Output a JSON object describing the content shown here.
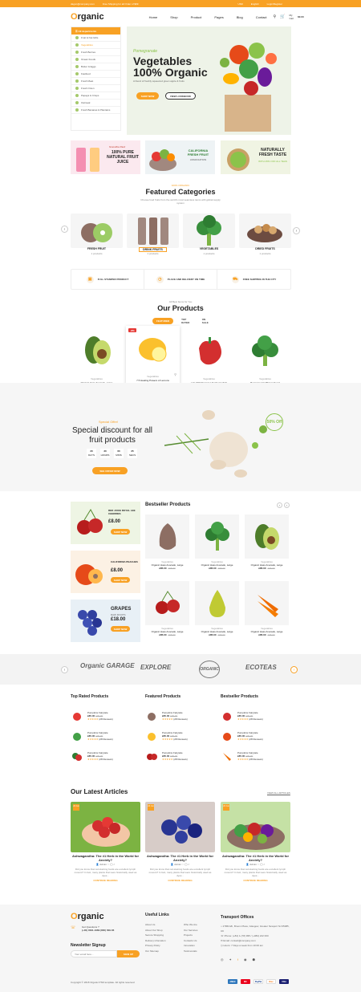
{
  "topbar": {
    "email": "dagon@company.com",
    "shipping": "Free Shipping for all Order of $99",
    "currency": "USD",
    "language": "English",
    "login": "Login/Register"
  },
  "header": {
    "logo_a": "O",
    "logo_b": "rganic",
    "nav": [
      "Home",
      "Shop",
      "Product",
      "Pages",
      "Blog",
      "Contact"
    ],
    "cart_label": "My Cart",
    "cart_total": "$0.00"
  },
  "categories": {
    "title": "All departments",
    "items": [
      "Fruit & Nut Gifts",
      "Vegetables",
      "Fresh Berries",
      "Ocean Foods",
      "Butter & Eggs",
      "Fastfood",
      "Fresh Meat",
      "Fresh Onion",
      "Papaya & Crisps",
      "Oatmeal",
      "Fresh Bananas & Plantains"
    ]
  },
  "hero": {
    "kicker": "Pomegranate",
    "title": "Vegetables 100% Organic",
    "desc": "A blend of freshly squeezed green apple & fruits",
    "btn1": "SHOP NOW",
    "btn2": "VIEW LOOKBOOK"
  },
  "promos": [
    {
      "sub": "Smoothie Pack",
      "title": "100% PURE NATURAL FRUIT JUICE"
    },
    {
      "title": "CALIFORNIA FRESH FRUIT",
      "sub": "ASSOCIATION"
    },
    {
      "title": "NATURALLY FRESH TASTE",
      "sub": "WITH 25% OFF ALL TEAS"
    }
  ],
  "featured": {
    "tag": "100% ORGANIC",
    "title": "Featured Categories",
    "sub": "Choose food fruits from the world's most seamless items with global supply system",
    "items": [
      {
        "name": "FRESH FRUIT",
        "count": "1 products"
      },
      {
        "name": "DRINK FRUITS",
        "count": "1 products"
      },
      {
        "name": "VEGETABLES",
        "count": "1 products"
      },
      {
        "name": "DRIED FRUITS",
        "count": "1 products"
      }
    ]
  },
  "features": [
    "FULL STAMPED PRODUCT",
    "PLACE AND DELIVERY ON TIME",
    "FREE SHIPPING IN THE CITY"
  ],
  "products": {
    "tag": "All Best Items for You",
    "title": "Our Products",
    "tabs": [
      "FEATURED",
      "TOP RATED",
      "ON SALE"
    ],
    "items": [
      {
        "cat": "Vegetables",
        "name": "Organic Hass Avocado, Large",
        "price": "£85.00",
        "old": "£95.00"
      },
      {
        "cat": "Vegetables",
        "name": "7.5 Healing Powers of Lemons",
        "price": "£85.00",
        "old": "£95.00",
        "badge": "-8%",
        "note": "80 products are currently selected to ensure fresh safety",
        "btn": "ADD TO CART"
      },
      {
        "cat": "Vegetables",
        "name": "Hot Chili Peppers Himalayan Salt",
        "price": "£85.00",
        "old": "£95.00"
      },
      {
        "cat": "Vegetables",
        "name": "Poonsam Cauliflower Kugel",
        "price": "£85.00",
        "old": "£95.00"
      }
    ]
  },
  "special": {
    "tag": "Special Offer!",
    "title": "Special discount for all fruit products",
    "countdown": [
      {
        "v": "20",
        "l": "DAYS"
      },
      {
        "v": "30",
        "l": "HOURS"
      },
      {
        "v": "60",
        "l": "MINS"
      },
      {
        "v": "25",
        "l": "SECS"
      }
    ],
    "btn": "SEE OFFER NOW",
    "badge": "50% Off"
  },
  "side": [
    {
      "title": "RED JUICE ROYAL LEE CHERRIES",
      "price": "£8.00",
      "btn": "SHOP NOW"
    },
    {
      "title": "CALIFORNIA PEACHES",
      "price": "£8.00",
      "btn": "SHOP NOW"
    },
    {
      "title": "GRAPES",
      "sub": "RAW FRUITS",
      "price": "£18.00",
      "btn": "SHOP NOW"
    }
  ],
  "bestseller": {
    "title": "Bestseller Products",
    "items": [
      {
        "cat": "Vegetables",
        "name": "Organic Hass Avocado, Large",
        "price": "£85.00",
        "old": "£95.00"
      },
      {
        "cat": "Vegetables",
        "name": "Organic Hass Avocado, Large",
        "price": "£85.00",
        "old": "£95.00"
      },
      {
        "cat": "Vegetables",
        "name": "Organic Hass Avocado, Large",
        "price": "£85.00",
        "old": "£95.00"
      },
      {
        "cat": "Vegetables",
        "name": "Organic Hass Avocado, Large",
        "price": "£85.00",
        "old": "£95.00"
      },
      {
        "cat": "Vegetables",
        "name": "Organic Hass Avocado, Large",
        "price": "£85.00",
        "old": "£95.00"
      },
      {
        "cat": "Vegetables",
        "name": "Organic Hass Avocado, Large",
        "price": "£85.00",
        "old": "£95.00"
      }
    ]
  },
  "brands": [
    "Organic GARAGE",
    "EXPLORE",
    "ORGANIC",
    "ECOTEAS"
  ],
  "lists": [
    {
      "title": "Top Rated Products"
    },
    {
      "title": "Featured Products"
    },
    {
      "title": "Bestseller Products"
    }
  ],
  "list_item": {
    "name": "Pumpkins Fairytale",
    "price": "£85.00",
    "old": "£95.00",
    "reviews": "(28 Reviews)"
  },
  "articles": {
    "title": "Our Latest Articles",
    "viewall": "VIEW ALL ARTICLES",
    "date": "24 Jun",
    "author": "Admin",
    "items": [
      {
        "title": "Ashwagandha: The #1 Herb in the World for Anxiety?",
        "ex": "Did you know that red-staining foods are excellent lymph movers? In fact, many plants that were historically used as dyes..."
      },
      {
        "title": "Ashwagandha: The #1 Herb in the World for Anxiety?",
        "ex": "Did you know that red-staining foods are excellent lymph movers? In fact, many plants that were historically used as dyes..."
      },
      {
        "title": "Ashwagandha: The #1 Herb in the World for Anxiety?",
        "ex": "Did you know that red-staining foods are excellent lymph movers? In fact, many plants that were historically used as dyes..."
      }
    ],
    "read": "CONTINUE READING"
  },
  "footer": {
    "q": "Got Questions ?",
    "phone": "(+00) 0091-1989 (800) 609-66",
    "news": "Newsletter Signup",
    "email_ph": "Your email here...",
    "signup": "SIGN UP",
    "links_title": "Useful Links",
    "links1": [
      "About Us",
      "About Our Shop",
      "Secure Shopping",
      "Delivery infomation",
      "Privacy Policy",
      "Our Sitemap"
    ],
    "links2": [
      "Who We Are",
      "Our Services",
      "Projects",
      "Contacts Us",
      "Innovation",
      "Testimonials"
    ],
    "offices_title": "Transport Offices",
    "addr": "2786/12b, Broom Place, Glasgow, Greater Newport NJ 05085, UK",
    "phone2": "Phone: (+84) 1-(78) 995 / (+084) 222 000",
    "email": "Email: contact@company.com",
    "hours": "Hours: 7 Days a week from 10:00 am",
    "copy": "Copyright © 2018 Organic PSD template. All rights reserved",
    "pays": [
      "AMEX",
      "MC",
      "PayPal",
      "Disc",
      "VISA"
    ]
  }
}
